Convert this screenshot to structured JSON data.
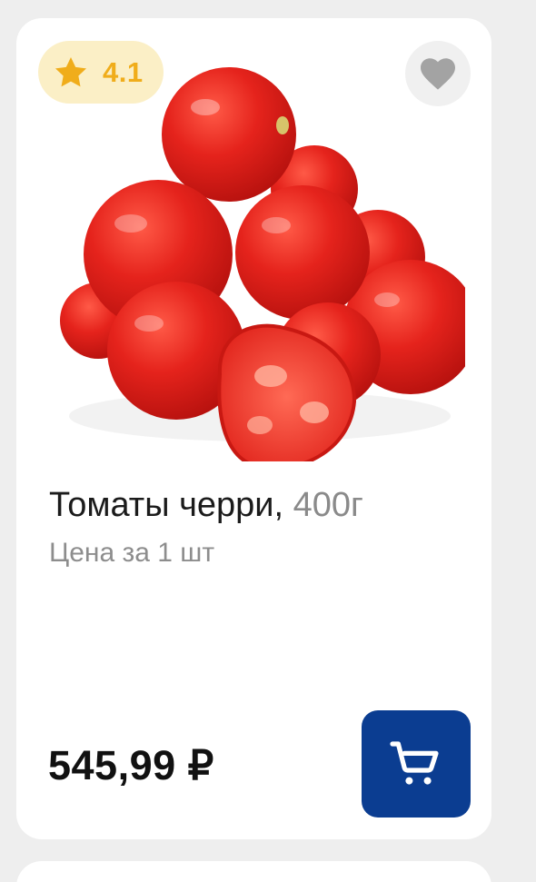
{
  "product": {
    "rating": "4.1",
    "title": "Томаты черри,",
    "weight": "400г",
    "subtitle": "Цена за 1 шт",
    "price": "545,99 ₽",
    "image_alt": "cherry-tomatoes"
  },
  "icons": {
    "rating": "star-icon",
    "favorite": "heart-icon",
    "cart": "cart-icon"
  },
  "colors": {
    "rating_badge_bg": "#fbefc6",
    "rating_text": "#f0ad1b",
    "cart_button": "#0b3d91",
    "tomato": "#e0221e"
  }
}
